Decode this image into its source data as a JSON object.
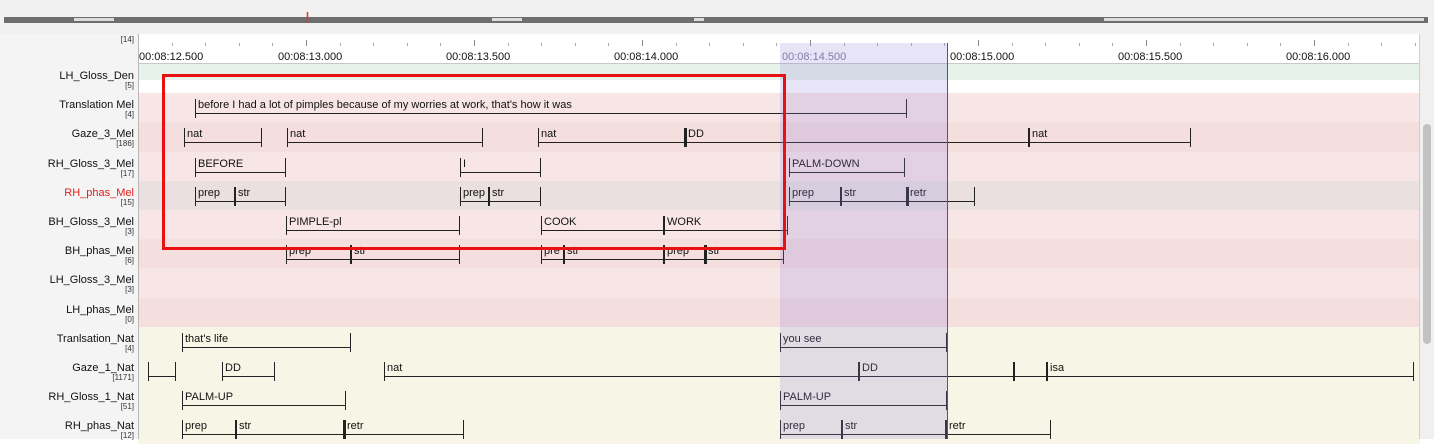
{
  "ruler": {
    "ticks": [
      "00:08:12.500",
      "00:08:13.000",
      "00:08:13.500",
      "00:08:14.000",
      "00:08:14.500",
      "00:08:15.000",
      "00:08:15.500",
      "00:08:16.000"
    ],
    "faded_tick_index": 4
  },
  "colors": {
    "mel_row": "#f8e6e6",
    "mel_row_alt": "#f4dede",
    "active_row": "#ebe0e0",
    "nat_row": "#f7f5e6",
    "den_row": "#e6f2ea",
    "selection": "#c9bdf0",
    "crosshair": "#e02020",
    "highlight_box": "#e81010",
    "active_label": "#e02020"
  },
  "tiers": [
    {
      "name": "LH_Gloss_Den",
      "count": "[5]",
      "top_count": "[14]",
      "annotations": []
    },
    {
      "name": "Translation Mel",
      "count": "[4]",
      "annotations": [
        {
          "text": "before I had a lot of pimples because of my worries at work, that's how it was"
        }
      ]
    },
    {
      "name": "Gaze_3_Mel",
      "count": "[186]",
      "annotations": [
        {
          "text": "nat"
        },
        {
          "text": "nat"
        },
        {
          "text": "nat"
        },
        {
          "text": "DD"
        },
        {
          "text": "nat"
        }
      ]
    },
    {
      "name": "RH_Gloss_3_Mel",
      "count": "[17]",
      "annotations": [
        {
          "text": "BEFORE"
        },
        {
          "text": "I"
        },
        {
          "text": "PALM-DOWN"
        }
      ]
    },
    {
      "name": "RH_phas_Mel",
      "count": "[15]",
      "active": true,
      "annotations": [
        {
          "text": "prep"
        },
        {
          "text": "str"
        },
        {
          "text": "prep"
        },
        {
          "text": "str"
        },
        {
          "text": "prep"
        },
        {
          "text": "str"
        },
        {
          "text": "retr"
        }
      ]
    },
    {
      "name": "BH_Gloss_3_Mel",
      "count": "[3]",
      "annotations": [
        {
          "text": "PIMPLE-pl"
        },
        {
          "text": "COOK"
        },
        {
          "text": "WORK"
        }
      ]
    },
    {
      "name": "BH_phas_Mel",
      "count": "[6]",
      "annotations": [
        {
          "text": "prep"
        },
        {
          "text": "str"
        },
        {
          "text": "pre"
        },
        {
          "text": "str"
        },
        {
          "text": "prep"
        },
        {
          "text": "str"
        }
      ]
    },
    {
      "name": "LH_Gloss_3_Mel",
      "count": "[3]",
      "annotations": []
    },
    {
      "name": "LH_phas_Mel",
      "count": "[0]",
      "annotations": []
    },
    {
      "name": "Tranlsation_Nat",
      "count": "[4]",
      "annotations": [
        {
          "text": "that's life"
        },
        {
          "text": "you see"
        }
      ]
    },
    {
      "name": "Gaze_1_Nat",
      "count": "[1171]",
      "annotations": [
        {
          "text": ""
        },
        {
          "text": "DD"
        },
        {
          "text": "nat"
        },
        {
          "text": "DD"
        },
        {
          "text": ""
        },
        {
          "text": "isa"
        }
      ]
    },
    {
      "name": "RH_Gloss_1_Nat",
      "count": "[51]",
      "annotations": [
        {
          "text": "PALM-UP"
        },
        {
          "text": "PALM-UP"
        }
      ]
    },
    {
      "name": "RH_phas_Nat",
      "count": "[12]",
      "annotations": [
        {
          "text": "prep"
        },
        {
          "text": "str"
        },
        {
          "text": "retr"
        },
        {
          "text": "prep"
        },
        {
          "text": "str"
        },
        {
          "text": "retr"
        }
      ]
    }
  ]
}
